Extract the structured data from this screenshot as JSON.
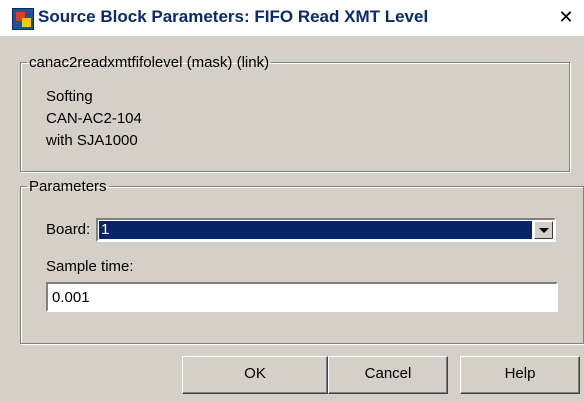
{
  "window": {
    "title": "Source Block Parameters: FIFO Read XMT Level",
    "close_glyph": "✕"
  },
  "mask_group": {
    "legend": "canac2readxmtfifolevel (mask) (link)",
    "description_lines": [
      "Softing",
      "CAN-AC2-104",
      "with SJA1000"
    ]
  },
  "parameters_group": {
    "legend": "Parameters",
    "board_label": "Board:",
    "board_value": "1",
    "sample_time_label": "Sample time:",
    "sample_time_value": "0.001"
  },
  "buttons": {
    "ok": "OK",
    "cancel": "Cancel",
    "help": "Help"
  },
  "icons": {
    "app": "simulink-block-icon",
    "close": "close-icon",
    "dropdown": "chevron-down-icon"
  }
}
